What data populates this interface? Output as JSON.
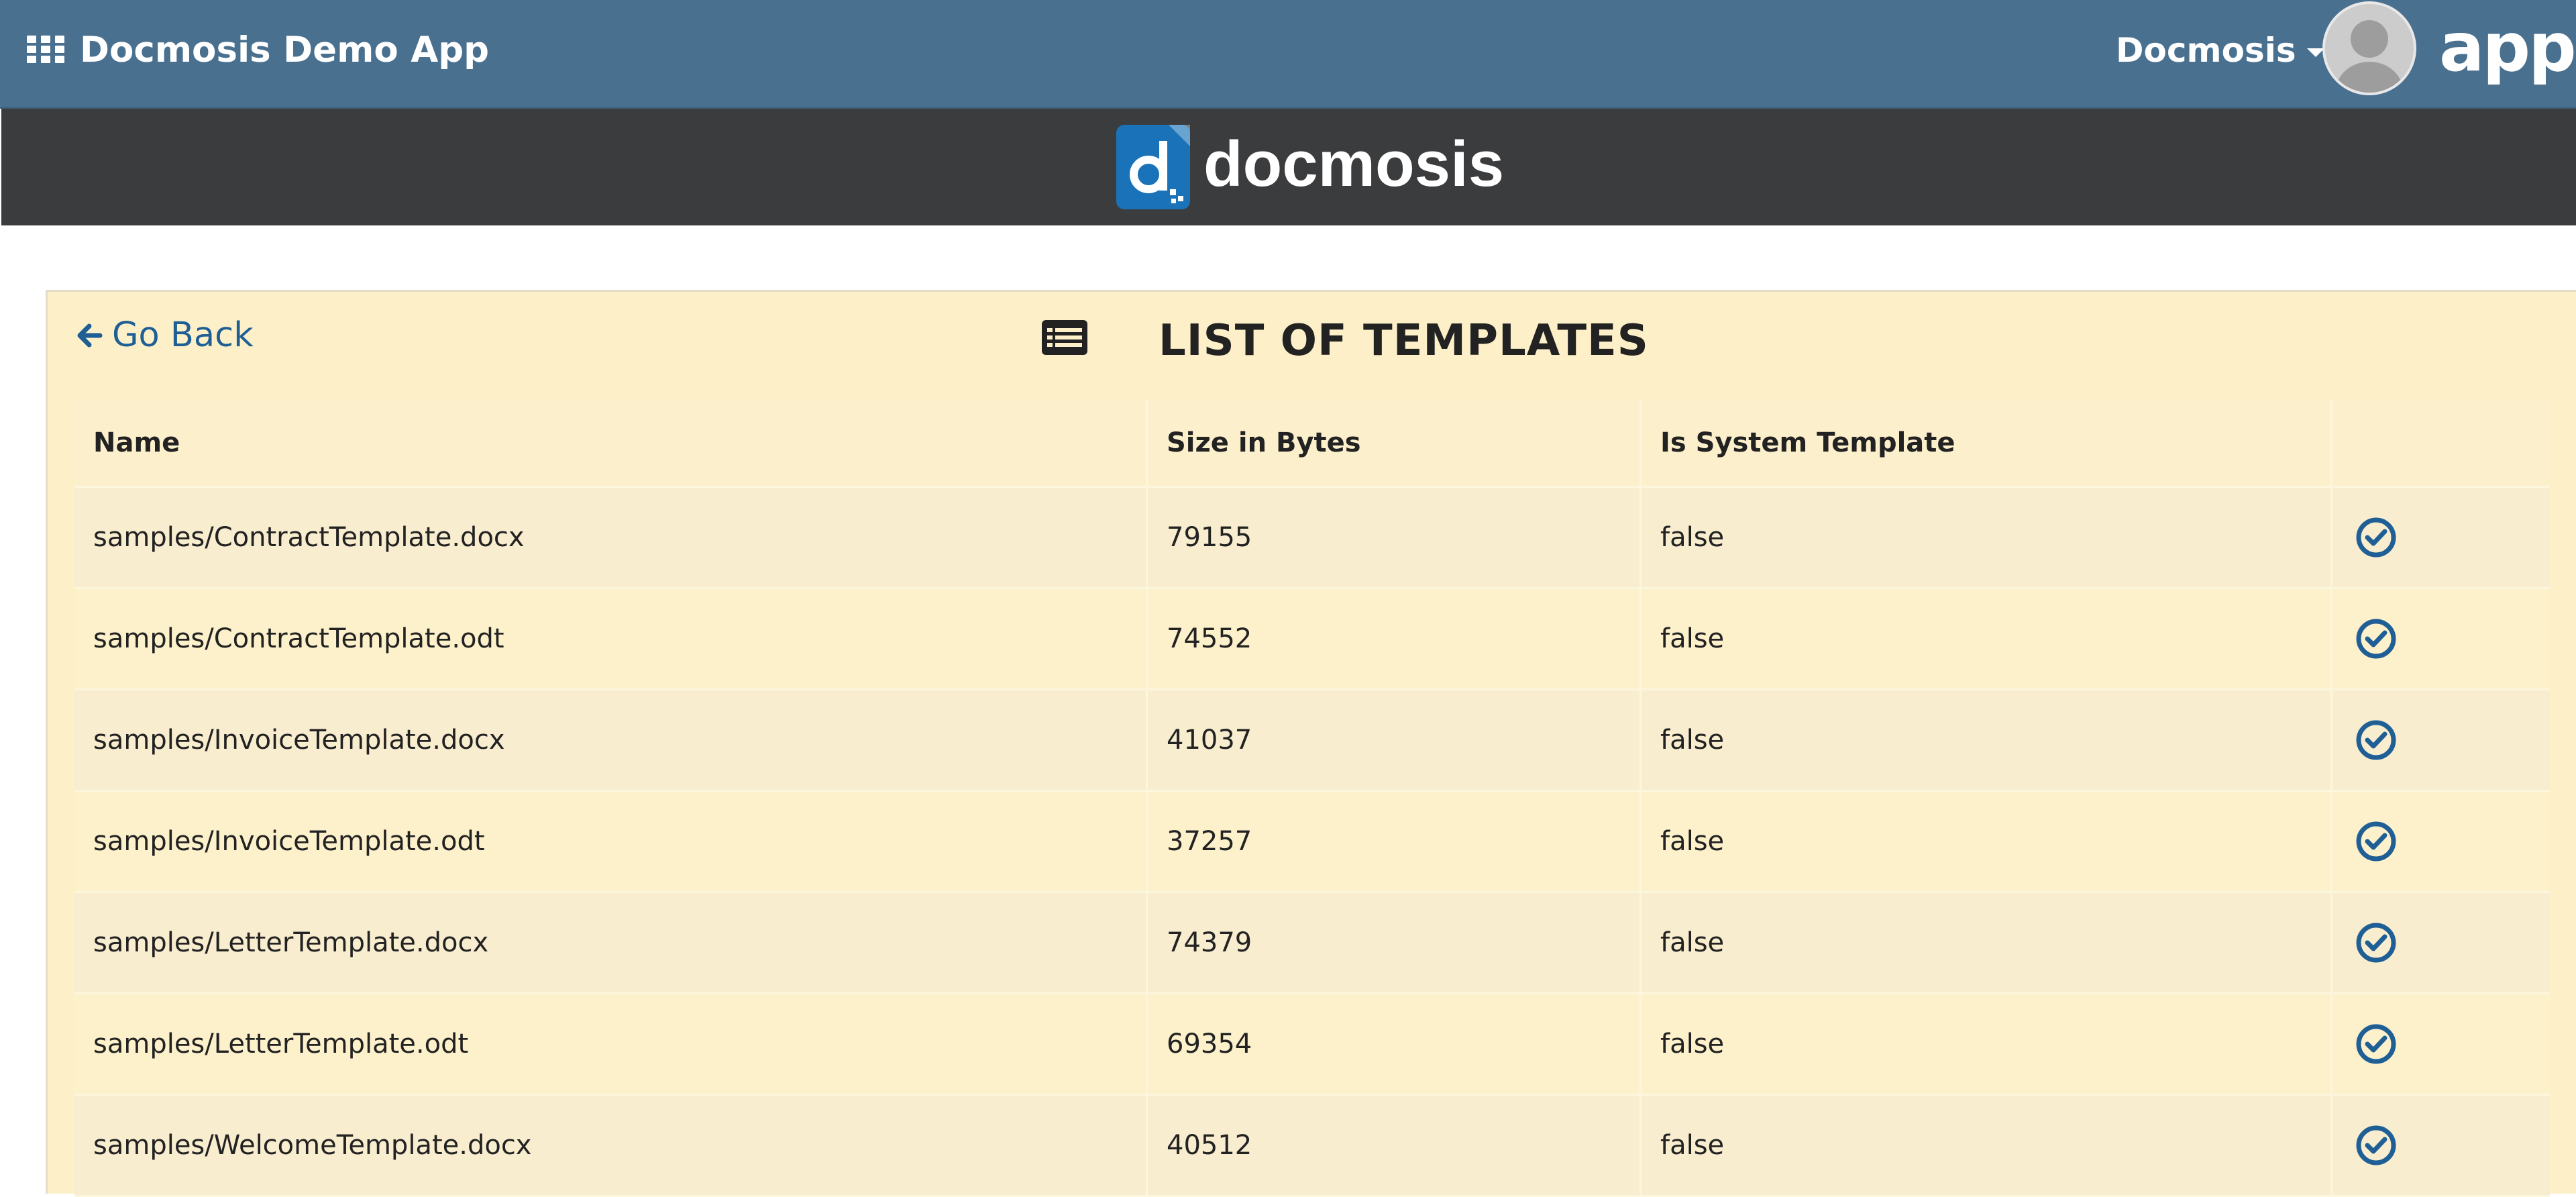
{
  "header": {
    "app_title": "Docmosis Demo App",
    "user_menu_label": "Docmosis",
    "platform_logo_text": "appian"
  },
  "brand": {
    "logo_text": "docmosis",
    "logo_color": "#1a73b8"
  },
  "panel": {
    "back_label": "Go Back",
    "title": "LIST OF TEMPLATES"
  },
  "table": {
    "columns": [
      "Name",
      "Size in Bytes",
      "Is System Template",
      ""
    ],
    "rows": [
      {
        "name": "samples/ContractTemplate.docx",
        "size": "79155",
        "system": "false"
      },
      {
        "name": "samples/ContractTemplate.odt",
        "size": "74552",
        "system": "false"
      },
      {
        "name": "samples/InvoiceTemplate.docx",
        "size": "41037",
        "system": "false"
      },
      {
        "name": "samples/InvoiceTemplate.odt",
        "size": "37257",
        "system": "false"
      },
      {
        "name": "samples/LetterTemplate.docx",
        "size": "74379",
        "system": "false"
      },
      {
        "name": "samples/LetterTemplate.odt",
        "size": "69354",
        "system": "false"
      },
      {
        "name": "samples/WelcomeTemplate.docx",
        "size": "40512",
        "system": "false"
      }
    ]
  },
  "colors": {
    "topbar": "#4a7090",
    "brandbar": "#3b3c3e",
    "panel_bg": "#fdf0c8",
    "link": "#1f5f95",
    "check_icon": "#1f5f95"
  },
  "icons": {
    "apps": "grid-icon",
    "caret": "chevron-down-icon",
    "back": "arrow-left-icon",
    "list": "list-icon",
    "select": "check-circle-icon"
  }
}
